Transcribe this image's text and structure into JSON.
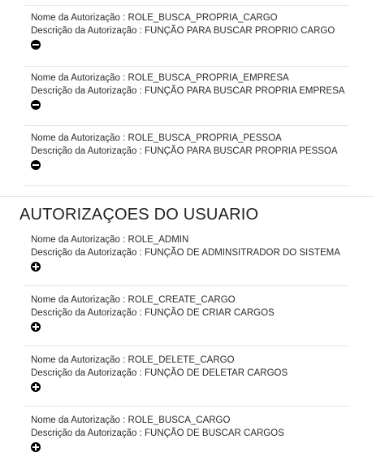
{
  "current_authorizations": [
    {
      "name_label": "Nome da Autorização : ROLE_BUSCA_PROPRIA_CARGO",
      "desc_label": "Descrição da Autorização : FUNÇÃO PARA BUSCAR PROPRIO CARGO",
      "action_icon": "remove-circle-icon"
    },
    {
      "name_label": "Nome da Autorização : ROLE_BUSCA_PROPRIA_EMPRESA",
      "desc_label": "Descrição da Autorização : FUNÇÃO PARA BUSCAR PROPRIA EMPRESA",
      "action_icon": "remove-circle-icon"
    },
    {
      "name_label": "Nome da Autorização : ROLE_BUSCA_PROPRIA_PESSOA",
      "desc_label": "Descrição da Autorização : FUNÇÃO PARA BUSCAR PROPRIA PESSOA",
      "action_icon": "remove-circle-icon"
    }
  ],
  "section": {
    "title": "AUTORIZAÇOES DO USUARIO"
  },
  "user_authorizations": [
    {
      "name_label": "Nome da Autorização : ROLE_ADMIN",
      "desc_label": "Descrição da Autorização : FUNÇÃO DE ADMINSITRADOR DO SISTEMA",
      "action_icon": "add-circle-icon"
    },
    {
      "name_label": "Nome da Autorização : ROLE_CREATE_CARGO",
      "desc_label": "Descrição da Autorização : FUNÇÃO DE CRIAR CARGOS",
      "action_icon": "add-circle-icon"
    },
    {
      "name_label": "Nome da Autorização : ROLE_DELETE_CARGO",
      "desc_label": "Descrição da Autorização : FUNÇÃO DE DELETAR CARGOS",
      "action_icon": "add-circle-icon"
    },
    {
      "name_label": "Nome da Autorização : ROLE_BUSCA_CARGO",
      "desc_label": "Descrição da Autorização : FUNÇÃO DE BUSCAR CARGOS",
      "action_icon": "add-circle-icon"
    }
  ]
}
